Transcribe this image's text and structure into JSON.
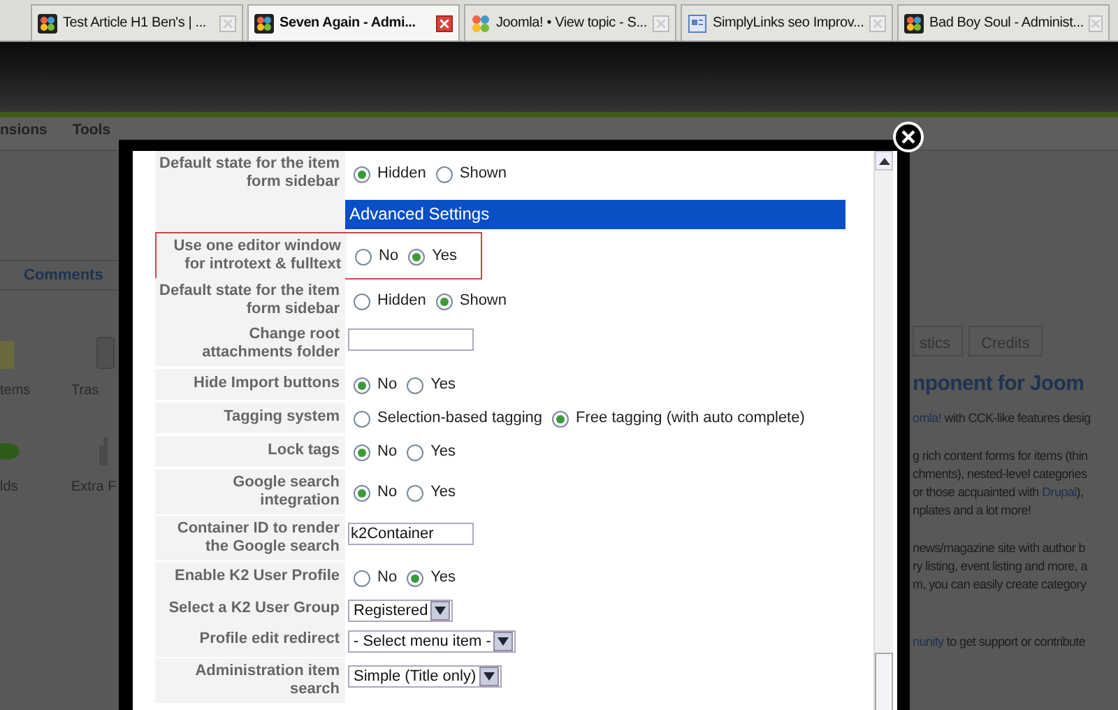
{
  "browser_tabs": [
    {
      "title": "Test Article H1 Ben's | ...",
      "kind": "logo",
      "selected": false
    },
    {
      "title": "Seven Again - Admi...",
      "kind": "logo",
      "selected": true
    },
    {
      "title": "Joomla! • View topic - S...",
      "kind": "flower",
      "selected": false
    },
    {
      "title": "SimplyLinks seo Improv...",
      "kind": "page",
      "selected": false
    },
    {
      "title": "Bad Boy Soul - Administ...",
      "kind": "logo",
      "selected": false
    }
  ],
  "background_page": {
    "menu": [
      "nsions",
      "Tools"
    ],
    "tab": "Comments",
    "left_icons": [
      {
        "label": "tems",
        "kind": "box"
      },
      {
        "label": "Tras",
        "kind": "bin"
      },
      {
        "label": "lds",
        "kind": "disc"
      },
      {
        "label": "Extra F",
        "kind": "hand"
      }
    ],
    "right_tabs": [
      "stics",
      "Credits"
    ],
    "heading": "nponent for Joom",
    "paragraphs": [
      [
        [
          {
            "text": "omla!",
            "link": true
          },
          {
            "text": " with CCK-like features desig",
            "link": false
          }
        ]
      ],
      [
        [
          {
            "text": "g rich content forms for items (thin",
            "link": false
          }
        ],
        [
          {
            "text": "chments), nested-level categories",
            "link": false
          }
        ],
        [
          {
            "text": "or those acquainted with ",
            "link": false
          },
          {
            "text": "Drupal",
            "link": true
          },
          {
            "text": "),",
            "link": false
          }
        ],
        [
          {
            "text": "nplates and a lot more!",
            "link": false
          }
        ]
      ],
      [
        [
          {
            "text": "news/magazine site with author b",
            "link": false
          }
        ],
        [
          {
            "text": "ry listing, event listing and more, a",
            "link": false
          }
        ],
        [
          {
            "text": "m, you can easily create category",
            "link": false
          }
        ]
      ],
      [
        [
          {
            "text": "nunity",
            "link": true
          },
          {
            "text": " to get support or contribute",
            "link": false
          }
        ]
      ]
    ]
  },
  "dialog": {
    "rows": [
      {
        "kind": "radio",
        "label": "Default state for the item form sidebar",
        "options": [
          {
            "label": "Hidden",
            "selected": true
          },
          {
            "label": "Shown",
            "selected": false
          }
        ]
      },
      {
        "kind": "section",
        "label": "Advanced Settings"
      },
      {
        "kind": "radio",
        "label": "Use one editor window for introtext & fulltext",
        "highlighted": true,
        "options": [
          {
            "label": "No",
            "selected": false
          },
          {
            "label": "Yes",
            "selected": true
          }
        ]
      },
      {
        "kind": "radio",
        "label": "Default state for the item form sidebar",
        "options": [
          {
            "label": "Hidden",
            "selected": false
          },
          {
            "label": "Shown",
            "selected": true
          }
        ]
      },
      {
        "kind": "text",
        "label": "Change root attachments folder"
      },
      {
        "kind": "radio",
        "label": "Hide Import buttons",
        "options": [
          {
            "label": "No",
            "selected": true
          },
          {
            "label": "Yes",
            "selected": false
          }
        ]
      },
      {
        "kind": "radio",
        "label": "Tagging system",
        "options": [
          {
            "label": "Selection-based tagging",
            "selected": false
          },
          {
            "label": "Free tagging (with auto complete)",
            "selected": true
          }
        ]
      },
      {
        "kind": "radio",
        "label": "Lock tags",
        "options": [
          {
            "label": "No",
            "selected": true
          },
          {
            "label": "Yes",
            "selected": false
          }
        ]
      },
      {
        "kind": "radio",
        "label": "Google search integration",
        "options": [
          {
            "label": "No",
            "selected": true
          },
          {
            "label": "Yes",
            "selected": false
          }
        ]
      },
      {
        "kind": "text",
        "label": "Container ID to render the Google search",
        "value": "k2Container"
      },
      {
        "kind": "radio",
        "label": "Enable K2 User Profile",
        "options": [
          {
            "label": "No",
            "selected": false
          },
          {
            "label": "Yes",
            "selected": true
          }
        ]
      },
      {
        "kind": "select",
        "label": "Select a K2 User Group",
        "value": "Registered"
      },
      {
        "kind": "select",
        "label": "Profile edit redirect",
        "value": "- Select menu item -"
      },
      {
        "kind": "select",
        "label": "Administration item search",
        "value": "Simple (Title only)"
      }
    ]
  }
}
